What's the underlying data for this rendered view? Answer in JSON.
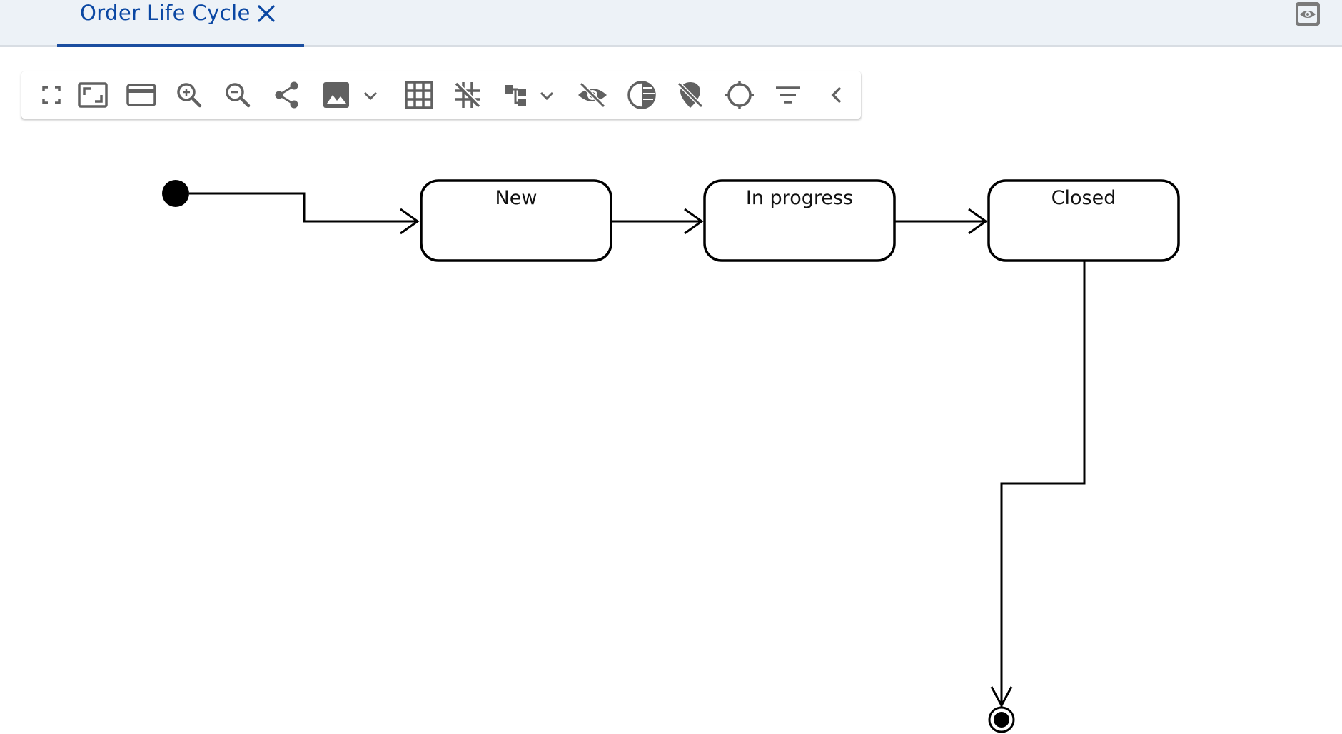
{
  "tab": {
    "title": "Order Life Cycle"
  },
  "toolbar": {
    "buttons": [
      {
        "name": "fullscreen-icon"
      },
      {
        "name": "fit-to-window-icon"
      },
      {
        "name": "panel-icon"
      },
      {
        "name": "zoom-in-icon"
      },
      {
        "name": "zoom-out-icon"
      },
      {
        "name": "share-icon"
      },
      {
        "name": "image-export-icon"
      },
      {
        "name": "grid-icon"
      },
      {
        "name": "snap-icon"
      },
      {
        "name": "layout-icon"
      },
      {
        "name": "hide-icon"
      },
      {
        "name": "contrast-icon"
      },
      {
        "name": "pin-off-icon"
      },
      {
        "name": "locate-icon"
      },
      {
        "name": "filter-icon"
      },
      {
        "name": "collapse-icon"
      }
    ]
  },
  "diagram": {
    "states": [
      {
        "label": "New"
      },
      {
        "label": "In progress"
      },
      {
        "label": "Closed"
      }
    ]
  },
  "colors": {
    "accent": "#0a47a3",
    "icon": "#616161",
    "stroke": "#000000"
  }
}
